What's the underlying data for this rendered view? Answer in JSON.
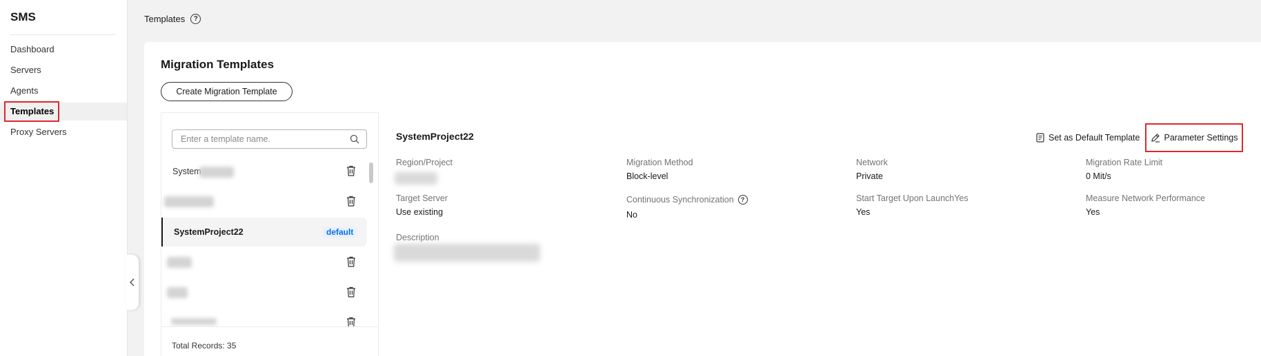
{
  "sidebar": {
    "brand": "SMS",
    "items": [
      {
        "label": "Dashboard"
      },
      {
        "label": "Servers"
      },
      {
        "label": "Agents"
      },
      {
        "label": "Templates"
      },
      {
        "label": "Proxy Servers"
      }
    ],
    "active_item": "Templates"
  },
  "header": {
    "title": "Templates",
    "help_glyph": "?"
  },
  "main": {
    "title": "Migration Templates",
    "create_button": "Create Migration Template",
    "search": {
      "placeholder": "Enter a template name.",
      "value": ""
    },
    "templates": [
      {
        "name": "System",
        "default": false
      },
      {
        "name": "",
        "default": false
      },
      {
        "name": "SystemProject22",
        "default": true
      },
      {
        "name": "",
        "default": false
      },
      {
        "name": "",
        "default": false
      },
      {
        "name": "",
        "default": false
      }
    ],
    "default_badge": "default",
    "total_records": "Total Records: 35"
  },
  "detail": {
    "title": "SystemProject22",
    "actions": {
      "set_default": "Set as Default Template",
      "parameter_settings": "Parameter Settings"
    },
    "fields": {
      "region_project": {
        "label": "Region/Project",
        "value": ""
      },
      "migration_method": {
        "label": "Migration Method",
        "value": "Block-level"
      },
      "network": {
        "label": "Network",
        "value": "Private"
      },
      "migration_rate_limit": {
        "label": "Migration Rate Limit",
        "value": "0 Mit/s"
      },
      "target_server": {
        "label": "Target Server",
        "value": "Use existing"
      },
      "continuous_sync": {
        "label": "Continuous Synchronization",
        "value": "No"
      },
      "start_target": {
        "label": "Start Target Upon LaunchYes",
        "value": "Yes"
      },
      "measure_network": {
        "label": "Measure Network Performance",
        "value": "Yes"
      },
      "description": {
        "label": "Description",
        "value": ""
      }
    }
  },
  "colors": {
    "highlight": "#e0262d",
    "badge_text": "#0a6fe6",
    "badge_bg": "#e8f1ff"
  }
}
